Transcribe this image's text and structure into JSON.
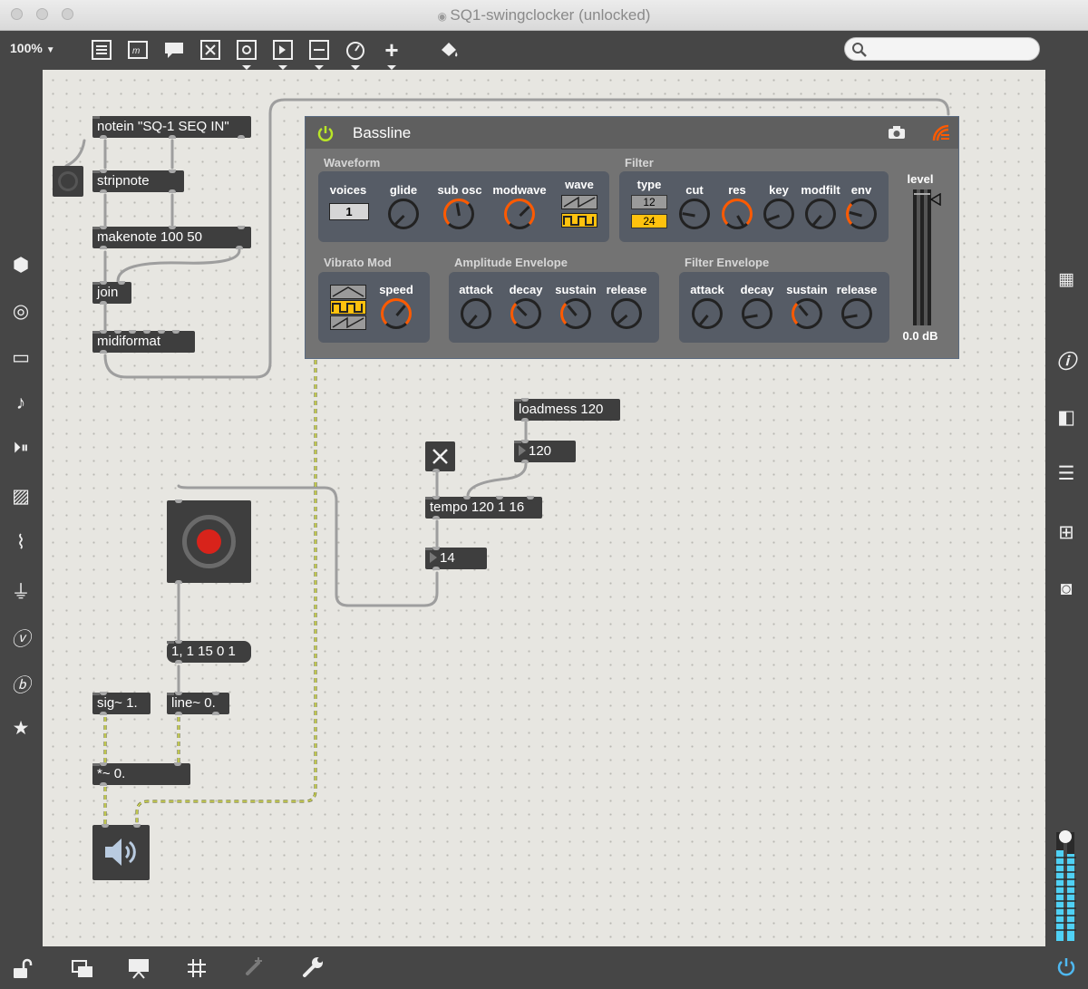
{
  "window": {
    "title": "SQ1-swingclocker (unlocked)"
  },
  "toolbar": {
    "zoom": "100%"
  },
  "patch": {
    "notein": "notein \"SQ-1 SEQ IN\"",
    "stripnote": "stripnote",
    "makenote": "makenote 100 50",
    "join": "join",
    "midiformat": "midiformat",
    "loadmess": "loadmess 120",
    "tempo_number": "120",
    "tempo": "tempo 120 1 16",
    "step_number": "14",
    "message": "1, 1 15 0 1",
    "sig": "sig~ 1.",
    "line": "line~ 0.",
    "mult": "*~ 0."
  },
  "bassline": {
    "title": "Bassline",
    "waveform": {
      "label": "Waveform",
      "voices_label": "voices",
      "voices_value": "1",
      "glide": "glide",
      "sub_osc": "sub osc",
      "modwave": "modwave",
      "wave": "wave"
    },
    "filter": {
      "label": "Filter",
      "type": "type",
      "type_12": "12",
      "type_24": "24",
      "cut": "cut",
      "res": "res",
      "key": "key",
      "modfilt": "modfilt",
      "env": "env"
    },
    "level": {
      "label": "level",
      "value": "0.0 dB"
    },
    "vibrato": {
      "label": "Vibrato Mod",
      "speed": "speed"
    },
    "amp_env": {
      "label": "Amplitude Envelope",
      "attack": "attack",
      "decay": "decay",
      "sustain": "sustain",
      "release": "release"
    },
    "filter_env": {
      "label": "Filter Envelope",
      "attack": "attack",
      "decay": "decay",
      "sustain": "sustain",
      "release": "release"
    }
  },
  "colors": {
    "accent_orange": "#ff5a00",
    "accent_yellow": "#ffc20e",
    "power_green": "#b9e627",
    "record_red": "#d8231b",
    "meter_blue": "#4fd1f5"
  }
}
